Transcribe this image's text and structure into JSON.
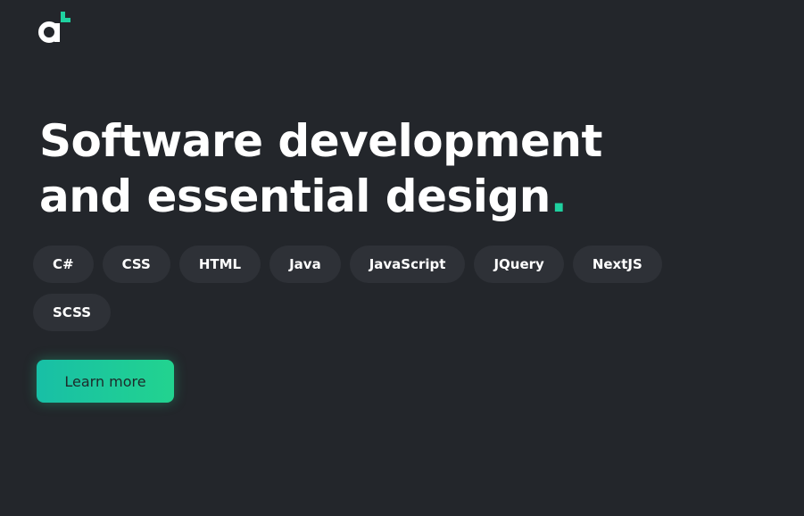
{
  "brand": {
    "logo_icon": "brand-logo-a-plus",
    "accent_color": "#1fd1a0"
  },
  "hero": {
    "title_line1": "Software development",
    "title_line2": "and essential design",
    "title_dot": "."
  },
  "tags": [
    {
      "label": "C#"
    },
    {
      "label": "CSS"
    },
    {
      "label": "HTML"
    },
    {
      "label": "Java"
    },
    {
      "label": "JavaScript"
    },
    {
      "label": "JQuery"
    },
    {
      "label": "NextJS"
    },
    {
      "label": "SCSS"
    }
  ],
  "cta": {
    "label": "Learn more"
  },
  "colors": {
    "background": "#23262b",
    "tag_background": "#2e3137",
    "button_gradient_start": "#18bfa6",
    "button_gradient_end": "#22d38f"
  }
}
